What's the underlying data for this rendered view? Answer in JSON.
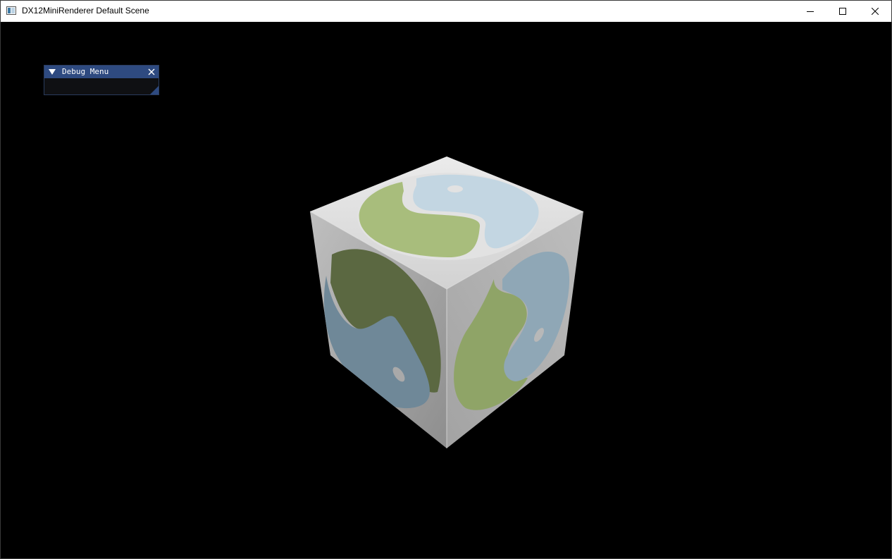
{
  "window": {
    "title": "DX12MiniRenderer Default Scene",
    "controls": {
      "minimize": "minimize-icon",
      "maximize": "maximize-icon",
      "close": "close-icon"
    }
  },
  "debug_menu": {
    "title": "Debug Menu",
    "collapse_icon": "triangle-down-icon",
    "close_icon": "close-icon",
    "header_color": "#2e4a80",
    "body_color": "#0f1013"
  },
  "scene": {
    "background": "#000000",
    "object": "textured-cube",
    "logo_colors": {
      "green": "#9bb170",
      "blue": "#b7d0e0",
      "dark_green": "#5e6e44",
      "dark_blue": "#708a9c",
      "face_white": "#d8d8d8"
    }
  }
}
